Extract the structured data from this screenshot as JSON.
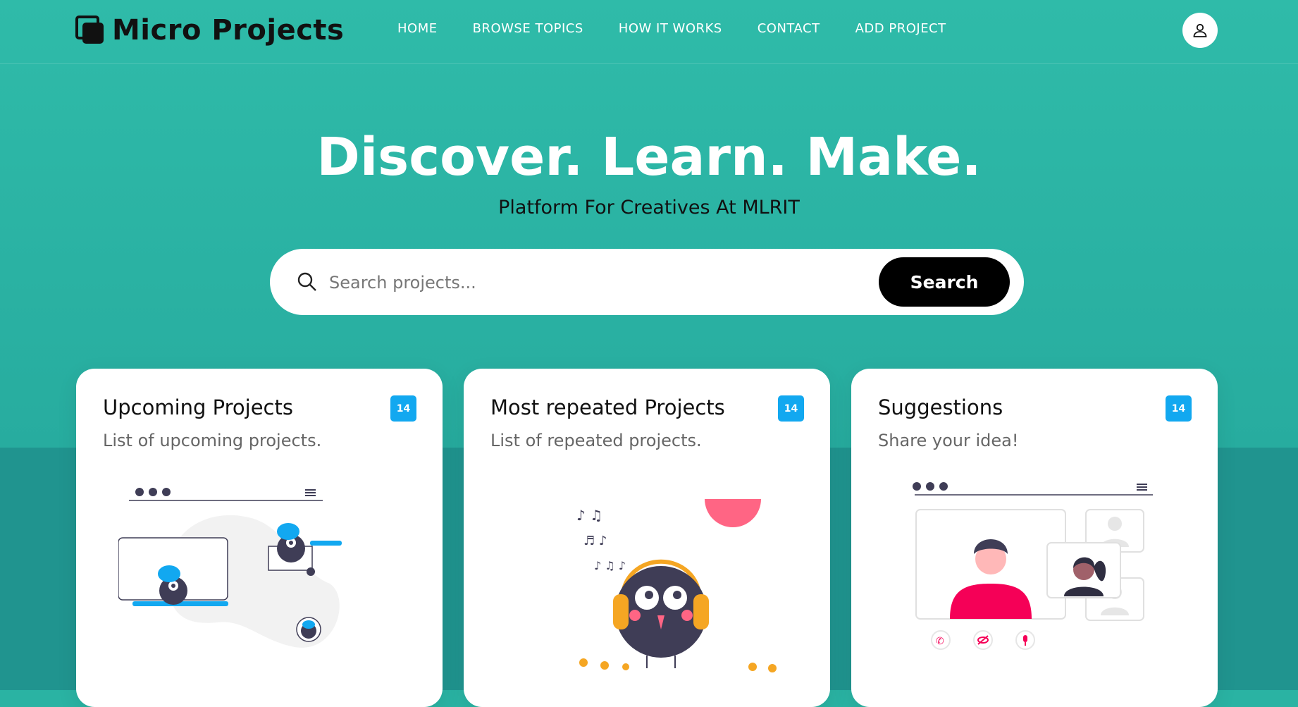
{
  "header": {
    "logo_text": "Micro Projects",
    "nav": [
      "HOME",
      "BROWSE TOPICS",
      "HOW IT WORKS",
      "CONTACT",
      "ADD PROJECT"
    ],
    "user_icon": "user-icon"
  },
  "hero": {
    "title": "Discover. Learn. Make.",
    "subtitle": "Platform For Creatives At MLRIT"
  },
  "search": {
    "placeholder": "Search projects...",
    "button_label": "Search",
    "icon": "search-icon"
  },
  "cards": [
    {
      "title": "Upcoming Projects",
      "description": "List of upcoming projects.",
      "badge": "14",
      "illustration": "online-work-illustration"
    },
    {
      "title": "Most repeated Projects",
      "description": "List of repeated projects.",
      "badge": "14",
      "illustration": "music-listening-illustration"
    },
    {
      "title": "Suggestions",
      "description": "Share your idea!",
      "badge": "14",
      "illustration": "video-call-illustration"
    }
  ],
  "colors": {
    "background": "#2ab3a3",
    "badge": "#12a8f0",
    "accent_blue": "#12a8f0",
    "accent_pink": "#f50057",
    "accent_orange": "#f5a623"
  }
}
